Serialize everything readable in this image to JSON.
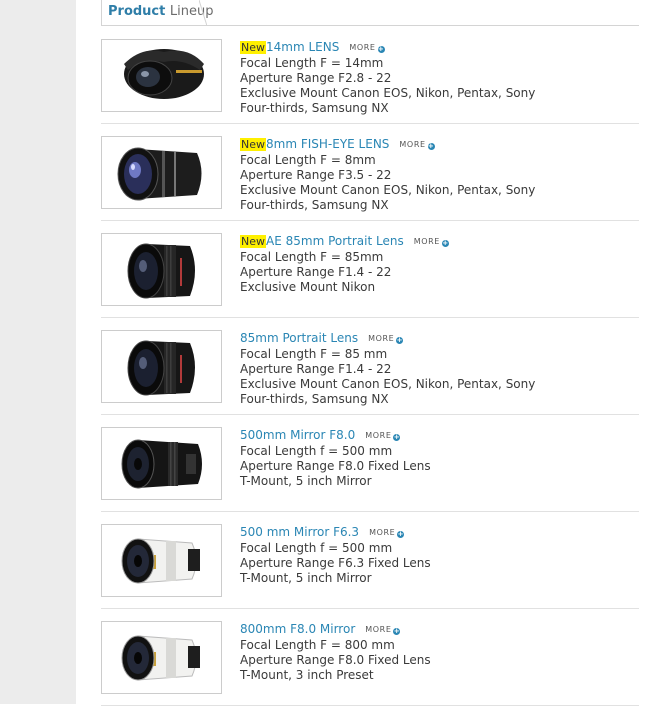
{
  "section": {
    "title_part1": "Product",
    "title_part2": "Lineup"
  },
  "more_label": "MORE",
  "more_icon": "plus-circle-icon",
  "accent_color": "#2a86b4",
  "badge_color": "#fff000",
  "products": [
    {
      "badge": "New",
      "title": "14mm LENS",
      "image": "wide-angle-lens-image",
      "specs": [
        "Focal Length F = 14mm",
        "Aperture Range F2.8 - 22",
        "Exclusive Mount Canon EOS, Nikon, Pentax, Sony",
        "Four-thirds, Samsung NX"
      ]
    },
    {
      "badge": "New",
      "title": "8mm FISH-EYE LENS",
      "image": "fisheye-lens-image",
      "specs": [
        "Focal Length F = 8mm",
        "Aperture Range F3.5 - 22",
        "Exclusive Mount Canon EOS, Nikon, Pentax, Sony",
        "Four-thirds, Samsung NX"
      ]
    },
    {
      "badge": "New",
      "title": "AE 85mm Portrait Lens",
      "image": "portrait-lens-image",
      "specs": [
        "Focal Length F = 85mm",
        "Aperture Range F1.4 - 22",
        "Exclusive Mount Nikon"
      ]
    },
    {
      "badge": "",
      "title": "85mm Portrait Lens",
      "image": "portrait-lens-image",
      "specs": [
        "Focal Length F = 85 mm",
        "Aperture Range F1.4 - 22",
        "Exclusive Mount Canon EOS, Nikon, Pentax, Sony",
        "Four-thirds, Samsung NX"
      ]
    },
    {
      "badge": "",
      "title": "500mm Mirror F8.0",
      "image": "black-mirror-lens-image",
      "specs": [
        "Focal Length f = 500 mm",
        "Aperture Range F8.0 Fixed Lens",
        "T-Mount, 5 inch Mirror"
      ]
    },
    {
      "badge": "",
      "title": "500 mm Mirror F6.3",
      "image": "white-mirror-lens-image",
      "specs": [
        "Focal Length f = 500 mm",
        "Aperture Range F6.3 Fixed Lens",
        "T-Mount, 5 inch Mirror"
      ]
    },
    {
      "badge": "",
      "title": "800mm F8.0 Mirror",
      "image": "white-mirror-lens-image",
      "specs": [
        "Focal Length F = 800 mm",
        "Aperture Range F8.0 Fixed Lens",
        "T-Mount, 3 inch Preset"
      ]
    }
  ]
}
